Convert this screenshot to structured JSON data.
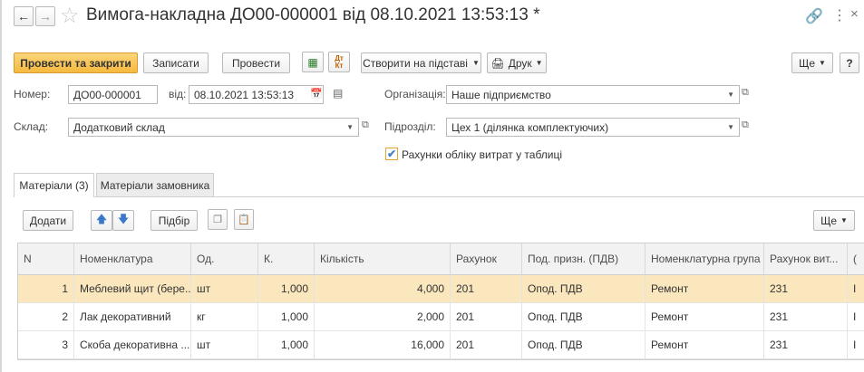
{
  "title": "Вимога-накладна ДО00-000001 від 08.10.2021 13:53:13 *",
  "toolbar": {
    "post_close": "Провести та закрити",
    "save": "Записати",
    "post": "Провести",
    "create_based": "Створити на підставі",
    "print": "Друк",
    "more": "Ще",
    "help": "?"
  },
  "form": {
    "number_label": "Номер:",
    "number_value": "ДО00-000001",
    "date_label": "від:",
    "date_value": "08.10.2021 13:53:13",
    "org_label": "Організація:",
    "org_value": "Наше підприємство",
    "warehouse_label": "Склад:",
    "warehouse_value": "Додатковий склад",
    "division_label": "Підрозділ:",
    "division_value": "Цех 1 (ділянка комплектуючих)",
    "checkbox_label": "Рахунки обліку витрат у таблиці",
    "checkbox_checked": true
  },
  "tabs": [
    {
      "label": "Матеріали (3)",
      "active": true
    },
    {
      "label": "Матеріали замовника",
      "active": false
    }
  ],
  "table_toolbar": {
    "add": "Додати",
    "select": "Підбір",
    "more": "Ще"
  },
  "table": {
    "headers": [
      "N",
      "Номенклатура",
      "Од.",
      "К.",
      "Кількість",
      "Рахунок",
      "Под. призн. (ПДВ)",
      "Номенклатурна група",
      "Рахунок вит...",
      "("
    ],
    "rows": [
      {
        "n": "1",
        "name": "Меблевий щит (бере...",
        "unit": "шт",
        "k": "1,000",
        "qty": "4,000",
        "account": "201",
        "vat": "Опод. ПДВ",
        "group": "Ремонт",
        "cost_account": "231",
        "extra": "I",
        "selected": true
      },
      {
        "n": "2",
        "name": "Лак декоративний",
        "unit": "кг",
        "k": "1,000",
        "qty": "2,000",
        "account": "201",
        "vat": "Опод. ПДВ",
        "group": "Ремонт",
        "cost_account": "231",
        "extra": "I",
        "selected": false
      },
      {
        "n": "3",
        "name": "Скоба декоративна ...",
        "unit": "шт",
        "k": "1,000",
        "qty": "16,000",
        "account": "201",
        "vat": "Опод. ПДВ",
        "group": "Ремонт",
        "cost_account": "231",
        "extra": "I",
        "selected": false
      }
    ]
  },
  "icons": {
    "back": "arrow-left-icon",
    "forward": "arrow-right-icon",
    "favorite": "star-icon",
    "link": "link-icon",
    "menu": "kebab-icon",
    "close": "close-icon"
  }
}
